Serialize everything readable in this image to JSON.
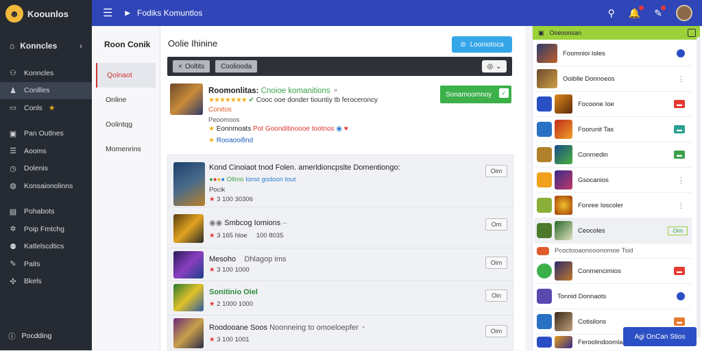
{
  "app": {
    "logo_text": "Koounlos"
  },
  "nav": {
    "main_label": "Konncles",
    "items": [
      {
        "label": "Konncles",
        "icon": "people-icon"
      },
      {
        "label": "Conllles",
        "icon": "gamepad-icon",
        "active": true
      },
      {
        "label": "Conls",
        "icon": "trophy-icon"
      }
    ],
    "items2": [
      {
        "label": "Pan Outlnes",
        "icon": "calendar-icon"
      },
      {
        "label": "Aooms",
        "icon": "list-icon"
      },
      {
        "label": "Dolenis",
        "icon": "clock-icon"
      },
      {
        "label": "Konsaionolinns",
        "icon": "globe-icon"
      }
    ],
    "items3": [
      {
        "label": "Pohabots",
        "icon": "box-icon"
      },
      {
        "label": "Poip Fmtchg",
        "icon": "gear-icon"
      },
      {
        "label": "Katlelscdtics",
        "icon": "users-icon"
      },
      {
        "label": "Paits",
        "icon": "doc-icon"
      },
      {
        "label": "Bkels",
        "icon": "wrench-icon"
      }
    ],
    "footer": "Pocdding"
  },
  "topbar": {
    "title": "Fodiks Komuntlos"
  },
  "sub": {
    "heading": "Roon Conik",
    "items": [
      "Qolnaot",
      "Online",
      "Oolintqg",
      "Momenrins"
    ]
  },
  "main": {
    "title": "Oolie Ihinine",
    "accent_button": "Looniotoca",
    "toolbar": {
      "chip1": "Ooltits",
      "chip2": "Cooliooda"
    },
    "featured": {
      "title": "Roomonlitas:",
      "title_green": "Cnoioe komanitions",
      "rating_text": "Cooc ooe donder tiountiy tb feroceroncy",
      "label_orange": "Conitos",
      "meta": "Peoomoos",
      "line5": "Eonnmoats",
      "line5_red": "Pot Goonditinoooe tootnos",
      "line6": "Rooaooifind",
      "cta": "Sonamoomnoy"
    },
    "rows": [
      {
        "title": "Kond Cinoiaot tnod Folen. amerldioncpslte Domentiongo:",
        "sub": "Pocik",
        "green": "Ollmo",
        "blue": "Ionst godoon tout",
        "meta": "3 100 30306",
        "btn": "Oim"
      },
      {
        "title": "Smbcog Iomions",
        "meta": "3 165 hloe",
        "meta2": "100 8035",
        "btn": "Om"
      },
      {
        "title": "Mesoho",
        "title2": "Dhlagop ims",
        "meta": "3 100 1000",
        "btn": "Oim"
      },
      {
        "title": "Sonitinio Oiel",
        "meta": "2 1000 1000",
        "btn": "Oin"
      },
      {
        "title": "Roodooane Soos",
        "title2": "Noonneing to omoeloepfer",
        "meta": "3 100 1001",
        "btn": "Oim"
      }
    ]
  },
  "right": {
    "header": "Ooeooosan",
    "items": [
      {
        "label": "Foomnioi Ioles"
      },
      {
        "label": "Ooiblle Donnoeos"
      },
      {
        "label": "Focoone Ioe"
      },
      {
        "label": "Foorunit Tas"
      },
      {
        "label": "Conrnedin"
      },
      {
        "label": "Gsocanios"
      },
      {
        "label": "Fonree Ioscoler"
      },
      {
        "label": "Ceocoles",
        "btn": "Oim"
      },
      {
        "label": "Pcoctooaonooonomoe Tsid"
      },
      {
        "label": "Conmencimios"
      },
      {
        "label": "Tonnid Donnaots"
      },
      {
        "label": "Cotisilons"
      },
      {
        "label": "Feroolindoomlas"
      }
    ],
    "float_button": "Agi OnCan Stios"
  }
}
